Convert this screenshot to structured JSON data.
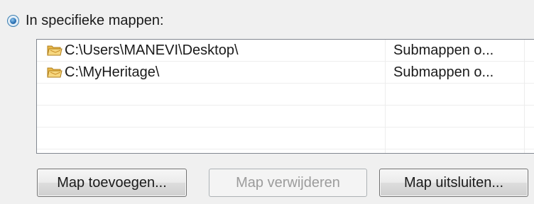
{
  "radio": {
    "label": "In specifieke mappen:",
    "selected": true
  },
  "folders": [
    {
      "path": "C:\\Users\\MANEVI\\Desktop\\",
      "subfolders": "Submappen o...",
      "icon": "folder-icon"
    },
    {
      "path": "C:\\MyHeritage\\",
      "subfolders": "Submappen o...",
      "icon": "folder-icon"
    }
  ],
  "buttons": {
    "add": "Map toevoegen...",
    "remove": "Map verwijderen",
    "exclude": "Map uitsluiten..."
  },
  "colors": {
    "folder": "#e8b84a",
    "radio_accent": "#2e74b6"
  }
}
